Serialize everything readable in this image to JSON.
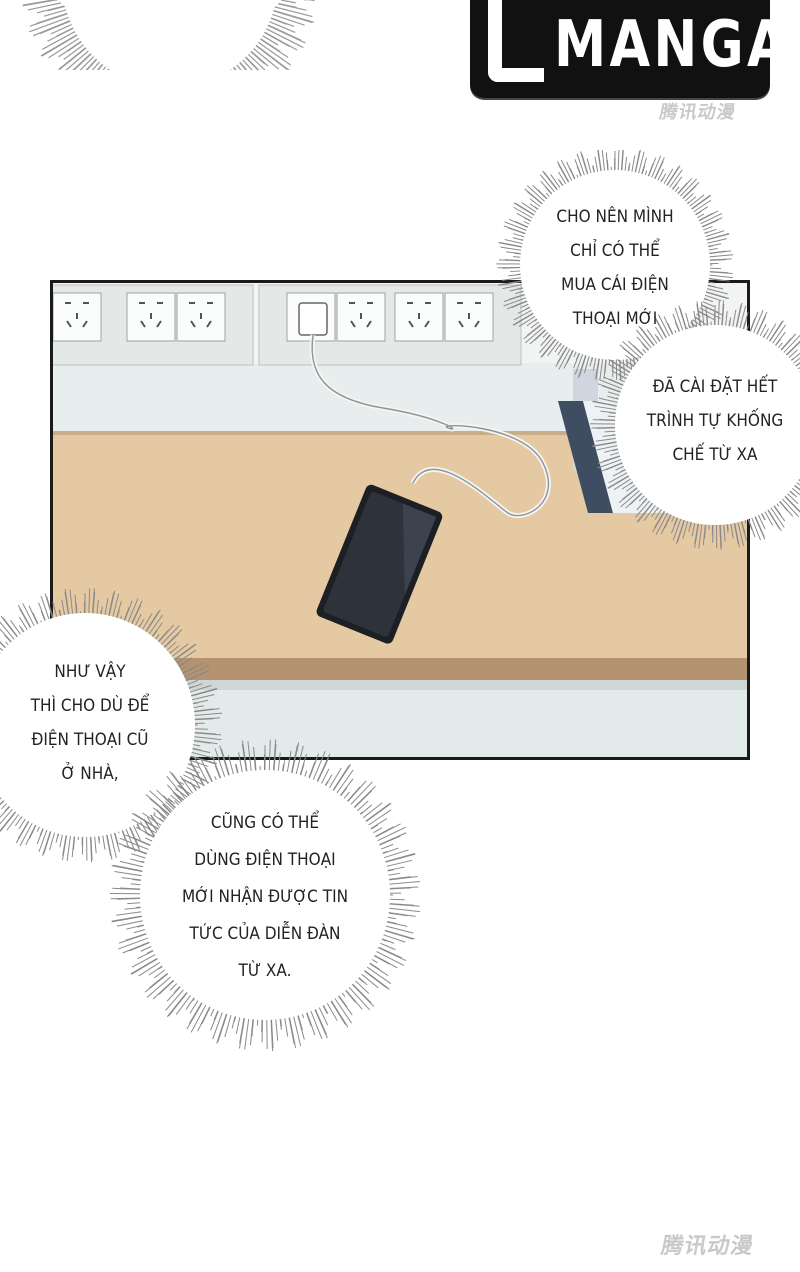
{
  "logo": {
    "text": "MANGA",
    "watermark": "腾讯动漫"
  },
  "bubbles": {
    "top_right": [
      "CHO NÊN MÌNH",
      "CHỈ CÓ THỂ",
      "MUA CÁI ĐIỆN",
      "THOẠI MỚI"
    ],
    "right": [
      "ĐÃ CÀI ĐẶT HẾT",
      "TRÌNH TỰ KHỐNG",
      "CHẾ TỪ XA"
    ],
    "left": [
      "NHƯ VẬY",
      "THÌ CHO DÙ ĐỂ",
      "ĐIỆN THOẠI CŨ",
      "Ở NHÀ,"
    ],
    "bottom": [
      "CŨNG CÓ THỂ",
      "DÙNG ĐIỆN THOẠI",
      "MỚI NHẬN ĐƯỢC TIN",
      "TỨC CỦA DIỄN ĐÀN",
      "TỪ XA."
    ]
  },
  "footer": {
    "watermark": "腾讯动漫"
  }
}
